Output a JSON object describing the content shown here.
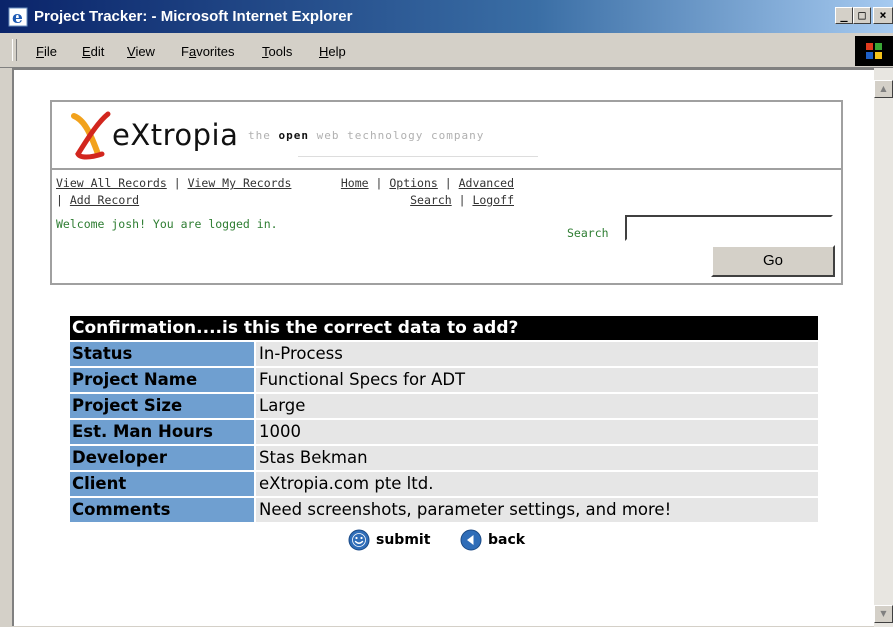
{
  "window": {
    "title": "Project Tracker: - Microsoft Internet Explorer"
  },
  "menu": [
    {
      "label": "File",
      "accel": "F",
      "rest": "ile"
    },
    {
      "label": "Edit",
      "accel": "E",
      "rest": "dit"
    },
    {
      "label": "View",
      "accel": "V",
      "rest": "iew"
    },
    {
      "label": "Favorites",
      "pre": "F",
      "accel": "a",
      "rest": "vorites"
    },
    {
      "label": "Tools",
      "accel": "T",
      "rest": "ools"
    },
    {
      "label": "Help",
      "accel": "H",
      "rest": "elp"
    }
  ],
  "header": {
    "logo_text": "eXtropia",
    "tagline_pre": "the ",
    "tagline_open": "open",
    "tagline_post": " web technology company",
    "nav_left": [
      "View All Records",
      "View My Records",
      "Add Record"
    ],
    "nav_right": [
      "Home",
      "Options",
      "Advanced Search",
      "Logoff"
    ],
    "welcome": "Welcome josh! You are logged in.",
    "search_label": "Search",
    "search_value": "",
    "go_label": "Go"
  },
  "confirmation": {
    "title": "Confirmation....is this the correct data to add?",
    "rows": [
      {
        "label": "Status",
        "value": "In-Process"
      },
      {
        "label": "Project Name",
        "value": "Functional Specs for ADT"
      },
      {
        "label": "Project Size",
        "value": "Large"
      },
      {
        "label": "Est. Man Hours",
        "value": "1000"
      },
      {
        "label": "Developer",
        "value": "Stas Bekman"
      },
      {
        "label": "Client",
        "value": "eXtropia.com pte ltd."
      },
      {
        "label": "Comments",
        "value": "Need screenshots, parameter settings, and more!"
      }
    ]
  },
  "actions": {
    "submit_label": "submit",
    "back_label": "back"
  },
  "colors": {
    "label_bg": "#6f9fd0",
    "value_bg": "#e6e6e6",
    "title_bg": "#000000",
    "welcome_text": "#2e7d32",
    "logo_red": "#d2261e",
    "logo_orange": "#f2a21c"
  }
}
